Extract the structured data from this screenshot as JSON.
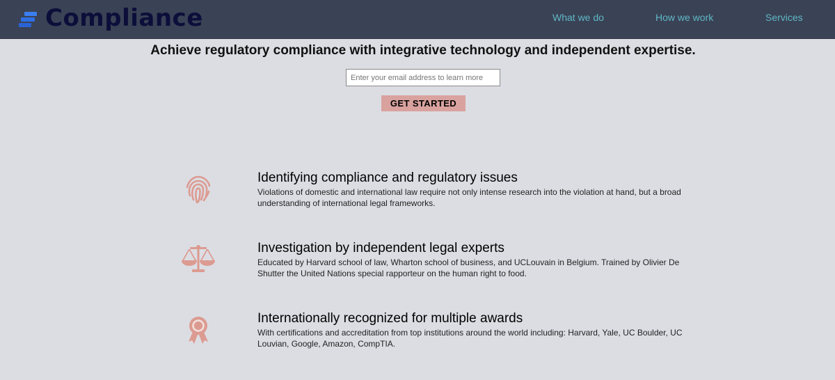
{
  "header": {
    "brand": "Compliance",
    "nav": [
      "What we do",
      "How we work",
      "Services"
    ]
  },
  "hero": {
    "title": "Achieve regulatory compliance with integrative technology and independent expertise.",
    "email_placeholder": "Enter your email address to learn more",
    "email_value": "",
    "cta_label": "GET STARTED"
  },
  "features": [
    {
      "icon": "fingerprint-icon",
      "title": "Identifying compliance and regulatory issues",
      "desc": "Violations of domestic and international law require not only intense research into the violation at hand, but a broad understanding of international legal frameworks."
    },
    {
      "icon": "scales-icon",
      "title": "Investigation by independent legal experts",
      "desc": "Educated by Harvard school of law, Wharton school of business, and UCLouvain in Belgium. Trained by Olivier De Shutter the United Nations special rapporteur on the human right to food."
    },
    {
      "icon": "award-ribbon-icon",
      "title": "Internationally recognized for multiple awards",
      "desc": "With certifications and accreditation from top institutions around the world including: Harvard, Yale, UC Boulder, UC Louvian, Google, Amazon, CompTIA."
    }
  ],
  "colors": {
    "header_bg": "#3a4255",
    "page_bg": "#dcdde3",
    "nav_link": "#5fb8c6",
    "accent": "#d9a29e",
    "logo_blue": "#2f6fe6",
    "logo_text": "#0c0e3a"
  }
}
